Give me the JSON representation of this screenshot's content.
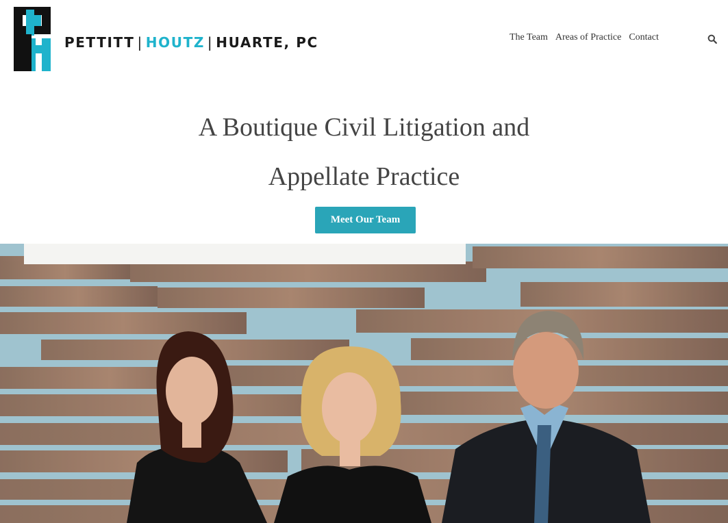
{
  "brand": {
    "name_part1": "PETTITT",
    "name_part2": "HOUTZ",
    "name_part3": "HUARTE, PC",
    "separator": "|",
    "accent_color": "#1fb3cc"
  },
  "nav": {
    "items": [
      {
        "label": "The Team"
      },
      {
        "label": "Areas of Practice"
      },
      {
        "label": "Contact"
      }
    ],
    "search_icon": "search-icon"
  },
  "hero": {
    "title_line1": "A Boutique Civil Litigation and",
    "title_line2": "Appellate Practice",
    "cta_label": "Meet Our Team",
    "cta_color": "#2aa5b8"
  }
}
